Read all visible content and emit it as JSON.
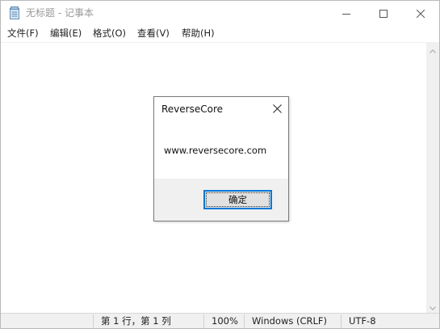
{
  "window": {
    "title": "无标题 - 记事本"
  },
  "menu": {
    "items": [
      {
        "label": "文件(F)"
      },
      {
        "label": "编辑(E)"
      },
      {
        "label": "格式(O)"
      },
      {
        "label": "查看(V)"
      },
      {
        "label": "帮助(H)"
      }
    ]
  },
  "editor": {
    "text": ""
  },
  "statusbar": {
    "position": "第 1 行，第 1 列",
    "zoom": "100%",
    "line_ending": "Windows (CRLF)",
    "encoding": "UTF-8"
  },
  "dialog": {
    "title": "ReverseCore",
    "message": "www.reversecore.com",
    "ok_label": "确定"
  },
  "colors": {
    "accent": "#0078d7",
    "statusbar_bg": "#f0f0f0",
    "dialog_footer_bg": "#f0f0f0"
  },
  "icons": {
    "app": "notepad-icon",
    "minimize": "minimize-icon",
    "maximize": "maximize-icon",
    "close": "close-icon",
    "dialog_close": "close-icon",
    "scroll_up": "chevron-up-icon",
    "scroll_down": "chevron-down-icon"
  }
}
